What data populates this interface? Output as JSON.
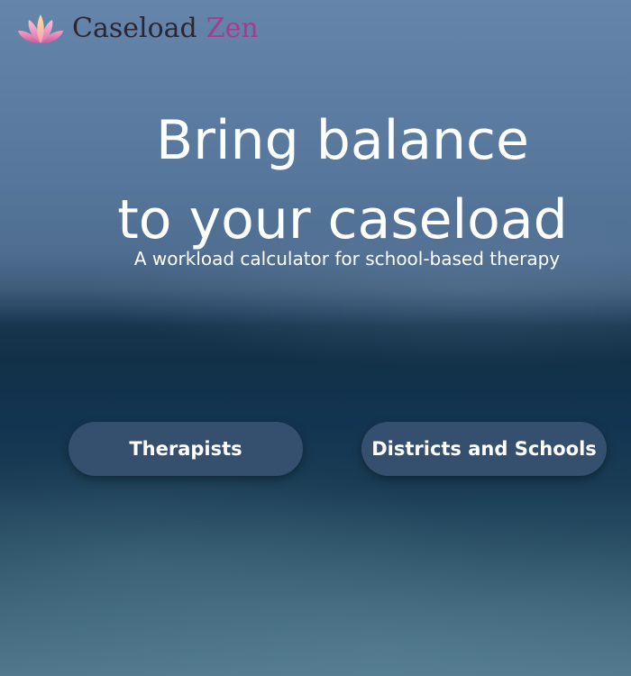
{
  "brand": {
    "name": "Caseload",
    "accent": "Zen",
    "logo_icon": "lotus-icon",
    "colors": {
      "name": "#2a2733",
      "accent": "#a43b90",
      "lotus": "#e07aa6"
    }
  },
  "hero": {
    "headline_line1": "Bring balance",
    "headline_line2": "to your caseload",
    "subhead": "A workload calculator for school-based therapy"
  },
  "actions": {
    "therapists_label": "Therapists",
    "districts_label": "Districts and Schools",
    "button_color": "#34506e"
  }
}
